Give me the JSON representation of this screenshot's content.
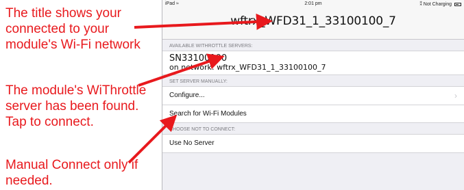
{
  "callouts": [
    "The title shows your\nconnected to your\nmodule's Wi-Fi network",
    "The module's WiThrottle\nserver has been found.\nTap to connect.",
    "Manual Connect only if\nneeded."
  ],
  "status_bar": {
    "left": "iPad ≈",
    "time": "2:01 pm",
    "right": "⁑ Not Charging"
  },
  "nav": {
    "title": "wftrx_WFD31_1_33100100_7"
  },
  "sections": {
    "available_header": "AVAILABLE WITHROTTLE SERVERS:",
    "manual_header": "SET SERVER MANUALLY:",
    "no_connect_header": "CHOOSE NOT TO CONNECT:"
  },
  "server": {
    "name": "SN33100100",
    "network": "on network: wftrx_WFD31_1_33100100_7"
  },
  "manual_items": [
    {
      "label": "Configure...",
      "icon": "chevron-right-icon"
    },
    {
      "label": "Search for Wi-Fi Modules"
    }
  ],
  "no_server": {
    "label": "Use No Server"
  },
  "colors": {
    "annotation": "#e8191d",
    "background": "#efeff4"
  }
}
